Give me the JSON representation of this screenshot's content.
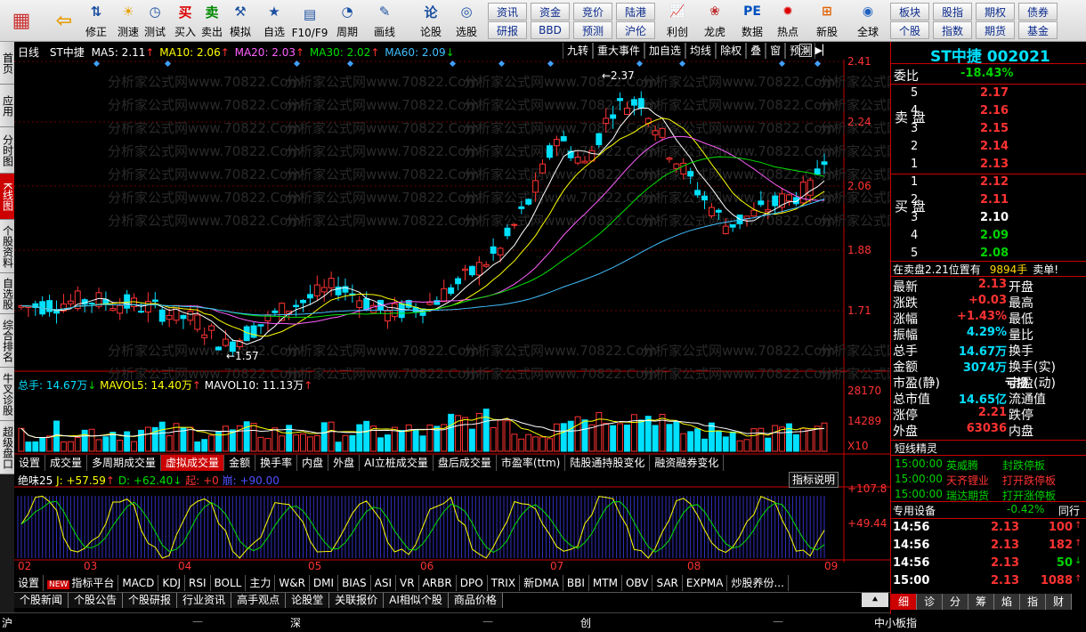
{
  "toolbar": {
    "buttons": [
      {
        "label": "",
        "icon": "grid-icon"
      },
      {
        "label": "",
        "icon": "back-arrow-icon"
      },
      {
        "label": "修正",
        "icon": "up-down-arrow-icon"
      },
      {
        "label": "测速",
        "icon": "speed-icon"
      },
      {
        "label": "测试",
        "icon": "clock-icon"
      },
      {
        "label": "买入",
        "icon": "buy-icon"
      },
      {
        "label": "卖出",
        "icon": "sell-icon"
      },
      {
        "label": "模拟",
        "icon": "hammer-icon"
      },
      {
        "label": "自选",
        "icon": "star-icon"
      },
      {
        "label": "F10/F9",
        "icon": "f10-icon"
      },
      {
        "label": "周期",
        "icon": "period-icon"
      },
      {
        "label": "画线",
        "icon": "pen-icon"
      },
      {
        "label": "论股",
        "icon": "forum-icon"
      },
      {
        "label": "选股",
        "icon": "search-icon"
      }
    ],
    "small_buttons_row1": [
      "资讯",
      "资金",
      "竞价",
      "陆港"
    ],
    "small_buttons_row2": [
      "研报",
      "BBD",
      "预测",
      "沪伦"
    ],
    "buttons2": [
      {
        "label": "利创",
        "icon": "chart-icon"
      },
      {
        "label": "龙虎",
        "icon": "dragon-icon"
      },
      {
        "label": "数据",
        "icon": "pe-icon"
      },
      {
        "label": "热点",
        "icon": "hot-icon"
      },
      {
        "label": "新股",
        "icon": "ipo-icon"
      },
      {
        "label": "全球",
        "icon": "globe-icon"
      }
    ],
    "small_buttons_row3": [
      "板块",
      "股指",
      "期权",
      "债券"
    ],
    "small_buttons_row4": [
      "个股",
      "指数",
      "期货",
      "基金"
    ]
  },
  "left_tabs": [
    "首页",
    "应用",
    "分时图",
    "K线图",
    "个股资料",
    "自选股",
    "综合排名",
    "牛叉诊股",
    "超级盘口"
  ],
  "chart_header": {
    "period": "日线",
    "name": "ST中捷",
    "ma5": "MA5: 2.11",
    "ma10": "MA10: 2.06",
    "ma20": "MA20: 2.03",
    "ma30": "MA30: 2.02",
    "ma60": "MA60: 2.09"
  },
  "chart_buttons": [
    "九转",
    "重大事件",
    "加自选",
    "均线",
    "除权",
    "叠",
    "窗",
    "预测"
  ],
  "watermark": "分析家公式网www.70822.Com",
  "price_axis": [
    "2.41",
    "2.24",
    "2.06",
    "1.88",
    "1.71"
  ],
  "high_label": "2.37",
  "low_label": "1.57",
  "volume_header": {
    "total": "总手: 14.67万",
    "mavol5": "MAVOL5: 14.40万",
    "mavol10": "MAVOL10: 11.13万"
  },
  "volume_axis": [
    "28170",
    "14289",
    "X10"
  ],
  "tabs1": [
    "设置",
    "成交量",
    "多周期成交量",
    "虚拟成交量",
    "金额",
    "换手率",
    "内盘",
    "外盘",
    "AI立桩成交量",
    "盘后成交量",
    "市盈率(ttm)",
    "陆股通持股变化",
    "融资融券变化"
  ],
  "indicator_note": "指标说明",
  "ind_header": {
    "name": "绝味25",
    "j": "J: +57.59",
    "d": "D: +62.40",
    "qi": "起: +0",
    "beng": "崩: +90.00"
  },
  "ind_axis": [
    "+107.8",
    "+49.44"
  ],
  "months": [
    "02",
    "03",
    "04",
    "05",
    "06",
    "07",
    "08",
    "09"
  ],
  "tabs2": [
    "设置",
    "指标平台",
    "MACD",
    "KDJ",
    "RSI",
    "BOLL",
    "主力",
    "W&R",
    "DMI",
    "BIAS",
    "ASI",
    "VR",
    "ARBR",
    "DPO",
    "TRIX",
    "新DMA",
    "BBI",
    "MTM",
    "OBV",
    "SAR",
    "EXPMA",
    "炒股养份..."
  ],
  "tabs2_new": "NEW",
  "tabs3": [
    "个股新闻",
    "个股公告",
    "个股研报",
    "行业资讯",
    "高手观点",
    "论股堂",
    "关联报价",
    "AI相似个股",
    "商品价格"
  ],
  "status_bar": [
    "沪",
    "深",
    "创",
    "中小板指"
  ],
  "quote": {
    "name": "ST中捷",
    "code": "002021",
    "weibi_label": "委比",
    "weibi": "-18.43%",
    "sell_label": "卖盘",
    "buy_label": "买盘",
    "sells": [
      {
        "lvl": "5",
        "price": "2.17"
      },
      {
        "lvl": "4",
        "price": "2.16"
      },
      {
        "lvl": "3",
        "price": "2.15"
      },
      {
        "lvl": "2",
        "price": "2.14"
      },
      {
        "lvl": "1",
        "price": "2.13"
      }
    ],
    "buys": [
      {
        "lvl": "1",
        "price": "2.12"
      },
      {
        "lvl": "2",
        "price": "2.11"
      },
      {
        "lvl": "3",
        "price": "2.10"
      },
      {
        "lvl": "4",
        "price": "2.09"
      },
      {
        "lvl": "5",
        "price": "2.08"
      }
    ],
    "ask_note": "在卖盘2.21位置有",
    "ask_qty": "9894手",
    "ask_tail": "卖单!",
    "stats_left": [
      {
        "k": "最新",
        "v": "2.13"
      },
      {
        "k": "涨跌",
        "v": "+0.03"
      },
      {
        "k": "涨幅",
        "v": "+1.43%"
      },
      {
        "k": "振幅",
        "v": "4.29%"
      },
      {
        "k": "总手",
        "v": "14.67万"
      },
      {
        "k": "金额",
        "v": "3074万"
      },
      {
        "k": "市盈(静)",
        "v": "亏损"
      },
      {
        "k": "总市值",
        "v": "14.65亿"
      },
      {
        "k": "涨停",
        "v": "2.21"
      },
      {
        "k": "外盘",
        "v": "63036"
      }
    ],
    "stats_right": [
      "开盘",
      "最高",
      "最低",
      "量比",
      "换手",
      "换手(实)",
      "市盈(动)",
      "流通值",
      "跌停",
      "内盘"
    ],
    "sprite_title": "短线精灵",
    "sprites": [
      {
        "time": "15:00:00",
        "name": "英威腾",
        "event": "封跌停板"
      },
      {
        "time": "15:00:00",
        "name": "天齐锂业",
        "event": "打开跌停板"
      },
      {
        "time": "15:00:00",
        "name": "瑞达期货",
        "event": "打开涨停板"
      }
    ],
    "special_label": "专用设备",
    "special_pct": "-0.42%",
    "special_tail": "同行",
    "ticks": [
      {
        "time": "14:56",
        "price": "2.13",
        "vol": "100"
      },
      {
        "time": "14:56",
        "price": "2.13",
        "vol": "182"
      },
      {
        "time": "14:56",
        "price": "2.13",
        "vol": "50"
      },
      {
        "time": "15:00",
        "price": "2.13",
        "vol": "1088"
      }
    ],
    "bottom_tabs": [
      "细",
      "诊",
      "分",
      "筹",
      "焰",
      "指",
      "财"
    ]
  },
  "colors": {
    "up": "#ff3232",
    "down": "#00e0ff",
    "ma5": "#ffffff",
    "ma10": "#ffff00",
    "ma20": "#ff60ff",
    "ma30": "#00e000",
    "ma60": "#40c0ff"
  }
}
